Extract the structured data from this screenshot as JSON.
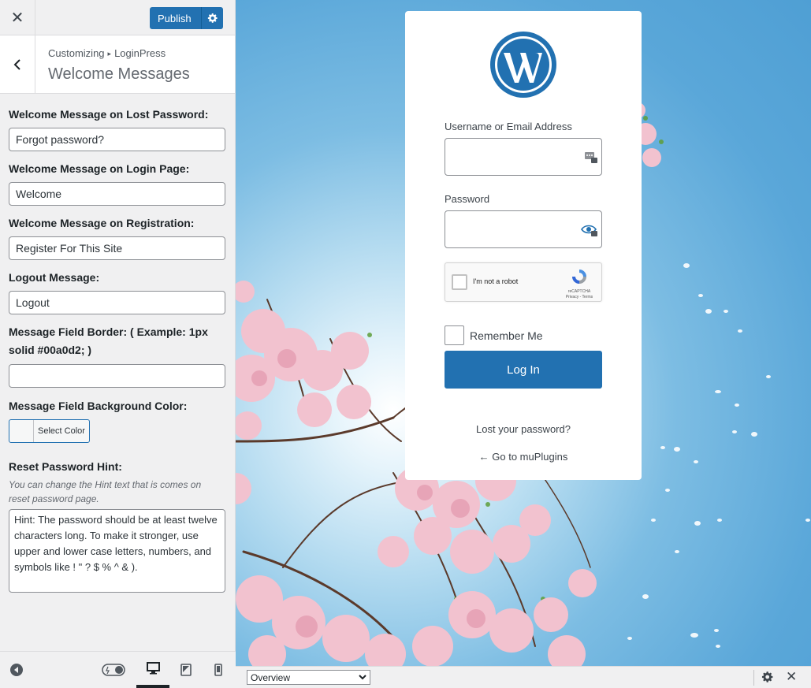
{
  "topbar": {
    "close_label": "✕",
    "publish_label": "Publish"
  },
  "section": {
    "breadcrumb_root": "Customizing",
    "breadcrumb_sep": "▸",
    "breadcrumb_child": "LoginPress",
    "title": "Welcome Messages"
  },
  "fields": {
    "lost_password": {
      "label": "Welcome Message on Lost Password:",
      "value": "Forgot password?"
    },
    "login_page": {
      "label": "Welcome Message on Login Page:",
      "value": "Welcome"
    },
    "registration": {
      "label": "Welcome Message on Registration:",
      "value": "Register For This Site"
    },
    "logout": {
      "label": "Logout Message:",
      "value": "Logout"
    },
    "border": {
      "label": "Message Field Border: ( Example: 1px solid #00a0d2; )",
      "value": ""
    },
    "bg_color": {
      "label": "Message Field Background Color:",
      "button_label": "Select Color"
    },
    "hint": {
      "label": "Reset Password Hint:",
      "description": "You can change the Hint text that is comes on reset password page.",
      "value": "Hint: The password should be at least twelve characters long. To make it stronger, use upper and lower case letters, numbers, and symbols like ! \" ? $ % ^ & )."
    }
  },
  "bottom_bar": {
    "icons": [
      "collapse-icon",
      "toggle-icon",
      "desktop-icon",
      "tablet-icon",
      "mobile-icon"
    ]
  },
  "login": {
    "username_label": "Username or Email Address",
    "password_label": "Password",
    "captcha_text": "I'm not a robot",
    "captcha_brand": "reCAPTCHA",
    "captcha_links": "Privacy - Terms",
    "remember_label": "Remember Me",
    "button_label": "Log In",
    "lost_password_link": "Lost your password?",
    "back_link": "← Go to muPlugins"
  },
  "statusbar": {
    "select_value": "Overview"
  },
  "colors": {
    "accent": "#2271b1",
    "sidebar_bg": "#f0f0f1",
    "sky": "#5aa7d9",
    "blossom": "#f2c2cf"
  }
}
